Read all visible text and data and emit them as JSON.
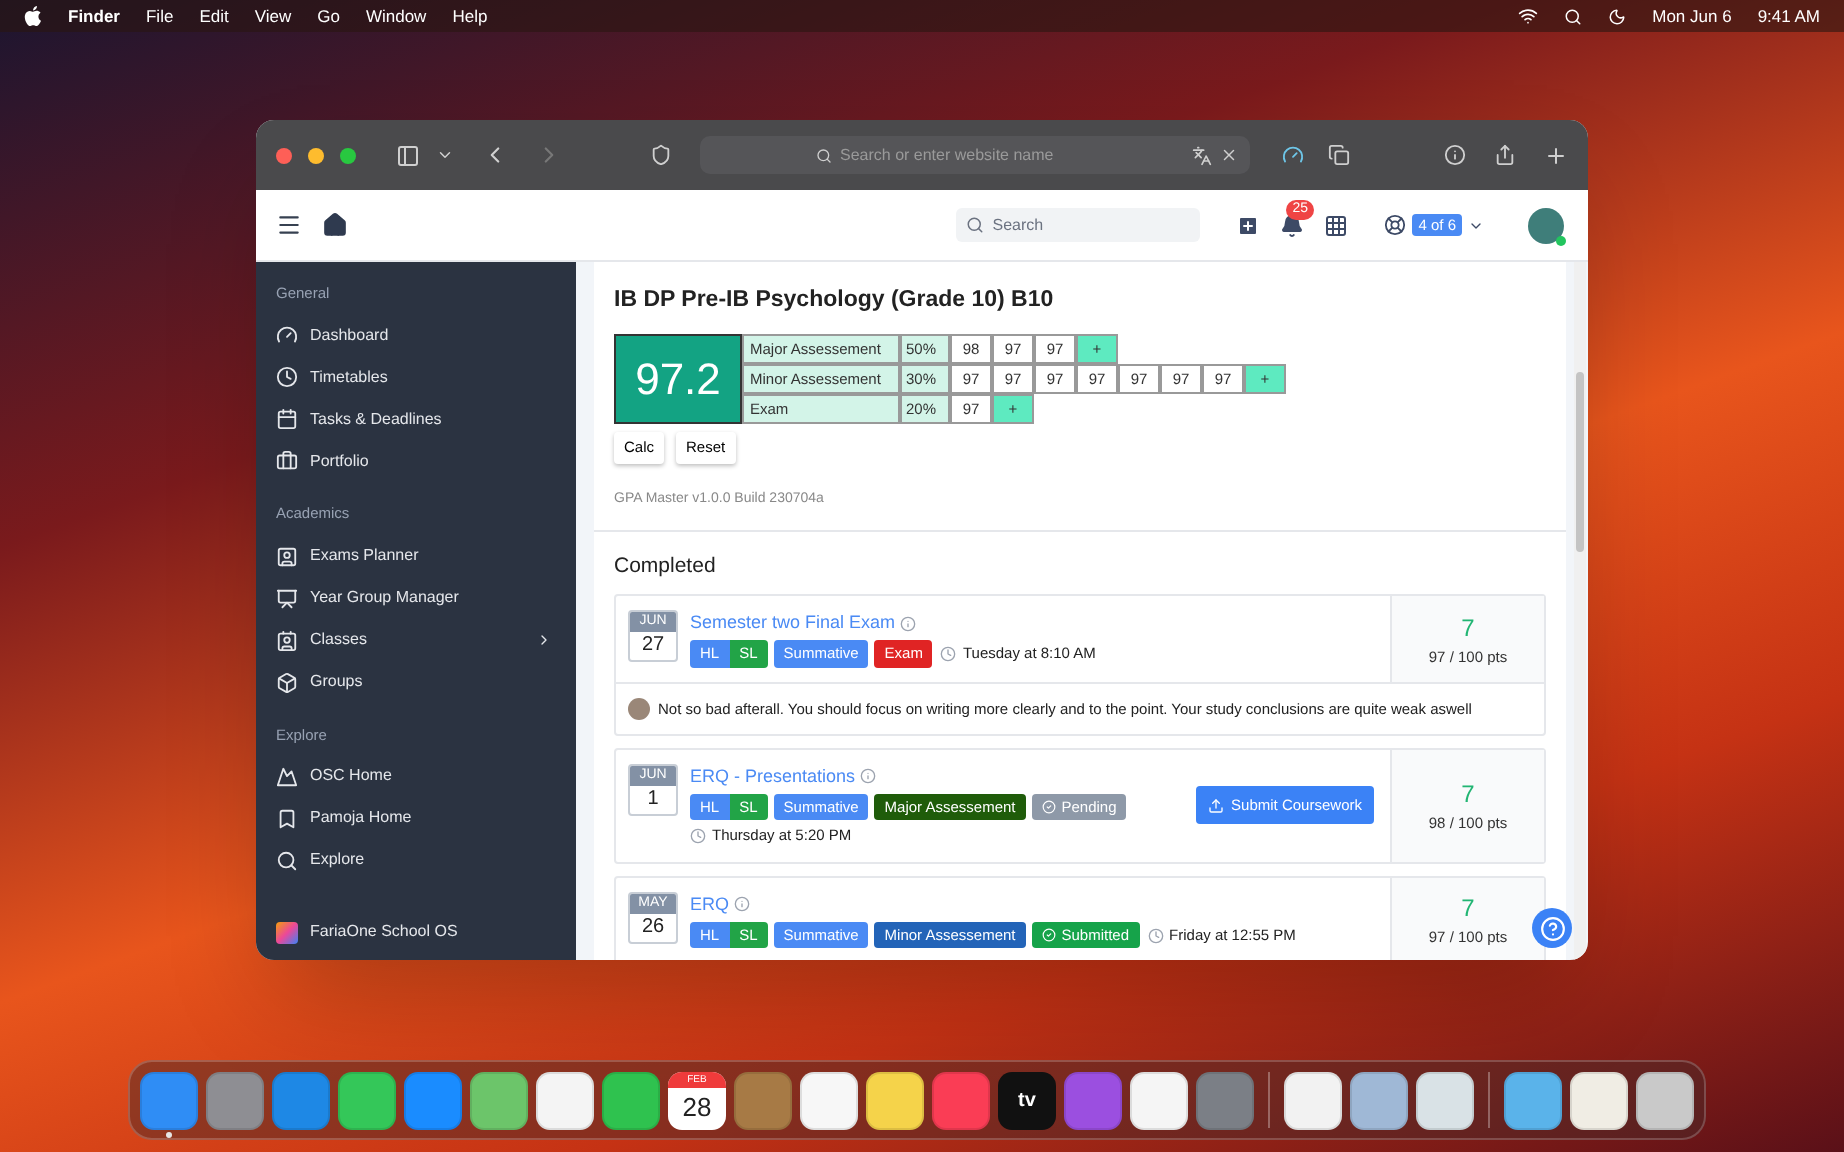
{
  "menu_bar": {
    "app": "Finder",
    "menus": [
      "File",
      "Edit",
      "View",
      "Go",
      "Window",
      "Help"
    ],
    "date": "Mon Jun 6",
    "time": "9:41 AM"
  },
  "browser": {
    "address_placeholder": "Search or enter website name"
  },
  "header": {
    "search_placeholder": "Search",
    "notification_count": "25",
    "school_switch": "4 of 6"
  },
  "sidebar": {
    "sections": [
      {
        "title": "General",
        "items": [
          {
            "label": "Dashboard",
            "expandable": false
          },
          {
            "label": "Timetables",
            "expandable": false
          },
          {
            "label": "Tasks & Deadlines",
            "expandable": false
          },
          {
            "label": "Portfolio",
            "expandable": false
          }
        ]
      },
      {
        "title": "Academics",
        "items": [
          {
            "label": "Exams Planner",
            "expandable": false
          },
          {
            "label": "Year Group Manager",
            "expandable": false
          },
          {
            "label": "Classes",
            "expandable": true
          },
          {
            "label": "Groups",
            "expandable": false
          }
        ]
      },
      {
        "title": "Explore",
        "items": [
          {
            "label": "OSC Home",
            "expandable": false
          },
          {
            "label": "Pamoja Home",
            "expandable": false
          },
          {
            "label": "Explore",
            "expandable": false
          }
        ]
      }
    ],
    "footer": "FariaOne School OS"
  },
  "course": {
    "title": "IB DP Pre-IB Psychology (Grade 10) B10",
    "average": "97.2",
    "rows": [
      {
        "name": "Major Assessement",
        "weight": "50%",
        "scores": [
          "98",
          "97",
          "97"
        ],
        "add": "+"
      },
      {
        "name": "Minor Assessement",
        "weight": "30%",
        "scores": [
          "97",
          "97",
          "97",
          "97",
          "97",
          "97",
          "97"
        ],
        "add": "+"
      },
      {
        "name": "Exam",
        "weight": "20%",
        "scores": [
          "97"
        ],
        "add": "+"
      }
    ],
    "buttons": [
      "Calc",
      "Reset"
    ],
    "version": "GPA Master v1.0.0 Build 230704a"
  },
  "completed": {
    "heading": "Completed",
    "tasks": [
      {
        "month": "JUN",
        "day": "27",
        "title": "Semester two Final Exam",
        "tags": [
          {
            "kind": "level",
            "left": "HL",
            "right": "SL"
          },
          {
            "kind": "tag",
            "text": "Summative",
            "color": "#4a8af4"
          },
          {
            "kind": "tag",
            "text": "Exam",
            "color": "#e02424"
          }
        ],
        "time": "Tuesday at 8:10 AM",
        "time_below": false,
        "grade": "7",
        "points": "97 / 100 pts",
        "comment": "Not so bad afterall. You should focus on writing more clearly and to the point. Your study conclusions are quite weak aswell"
      },
      {
        "month": "JUN",
        "day": "1",
        "title": "ERQ - Presentations",
        "tags": [
          {
            "kind": "level",
            "left": "HL",
            "right": "SL"
          },
          {
            "kind": "tag",
            "text": "Summative",
            "color": "#4a8af4"
          },
          {
            "kind": "tag",
            "text": "Major Assessement",
            "color": "#1f5c0a"
          },
          {
            "kind": "status",
            "text": "Pending",
            "color": "#8e99a8"
          }
        ],
        "time": "Thursday at 5:20 PM",
        "time_below": true,
        "action": "Submit Coursework",
        "grade": "7",
        "points": "98 / 100 pts"
      },
      {
        "month": "MAY",
        "day": "26",
        "title": "ERQ",
        "tags": [
          {
            "kind": "level",
            "left": "HL",
            "right": "SL"
          },
          {
            "kind": "tag",
            "text": "Summative",
            "color": "#4a8af4"
          },
          {
            "kind": "tag",
            "text": "Minor Assessement",
            "color": "#2364b8"
          },
          {
            "kind": "status",
            "text": "Submitted",
            "color": "#16a34a"
          }
        ],
        "time": "Friday at 12:55 PM",
        "time_below": false,
        "grade": "7",
        "points": "97 / 100 pts"
      }
    ]
  },
  "dock": {
    "groups": [
      [
        {
          "kind": "app",
          "color": "#2f8df5",
          "running": true
        },
        {
          "kind": "app",
          "color": "#8e8e93",
          "running": false
        },
        {
          "kind": "app",
          "color": "#1e88e5",
          "running": false
        },
        {
          "kind": "app",
          "color": "#34c759",
          "running": false
        },
        {
          "kind": "app",
          "color": "#1a8cff",
          "running": false
        },
        {
          "kind": "app",
          "color": "#6cc56a",
          "running": false
        },
        {
          "kind": "app",
          "color": "#f4f4f4",
          "running": false
        },
        {
          "kind": "app",
          "color": "#2fc24f",
          "running": false
        },
        {
          "kind": "calendar",
          "color": "#ffffff",
          "month": "FEB",
          "day": "28",
          "running": false
        },
        {
          "kind": "app",
          "color": "#a77a45",
          "running": false
        },
        {
          "kind": "app",
          "color": "#f7f7f7",
          "running": false
        },
        {
          "kind": "app",
          "color": "#f5d34a",
          "running": false
        },
        {
          "kind": "app",
          "color": "#fa3d55",
          "running": false
        },
        {
          "kind": "tv",
          "color": "#111111",
          "label": "tv",
          "running": false
        },
        {
          "kind": "app",
          "color": "#9b4fe0",
          "running": false
        },
        {
          "kind": "app",
          "color": "#f5f5f5",
          "running": false
        },
        {
          "kind": "app",
          "color": "#7b7f86",
          "running": false
        }
      ],
      [
        {
          "kind": "app",
          "color": "#f2f2f2",
          "running": false
        },
        {
          "kind": "app",
          "color": "#9fb8d6",
          "running": false
        },
        {
          "kind": "app",
          "color": "#d9e2e6",
          "running": false
        }
      ],
      [
        {
          "kind": "app",
          "color": "#5ab3ea",
          "running": false
        },
        {
          "kind": "app",
          "color": "#f0ede4",
          "running": false
        },
        {
          "kind": "app",
          "color": "#c9c9c9",
          "running": false
        }
      ]
    ]
  }
}
